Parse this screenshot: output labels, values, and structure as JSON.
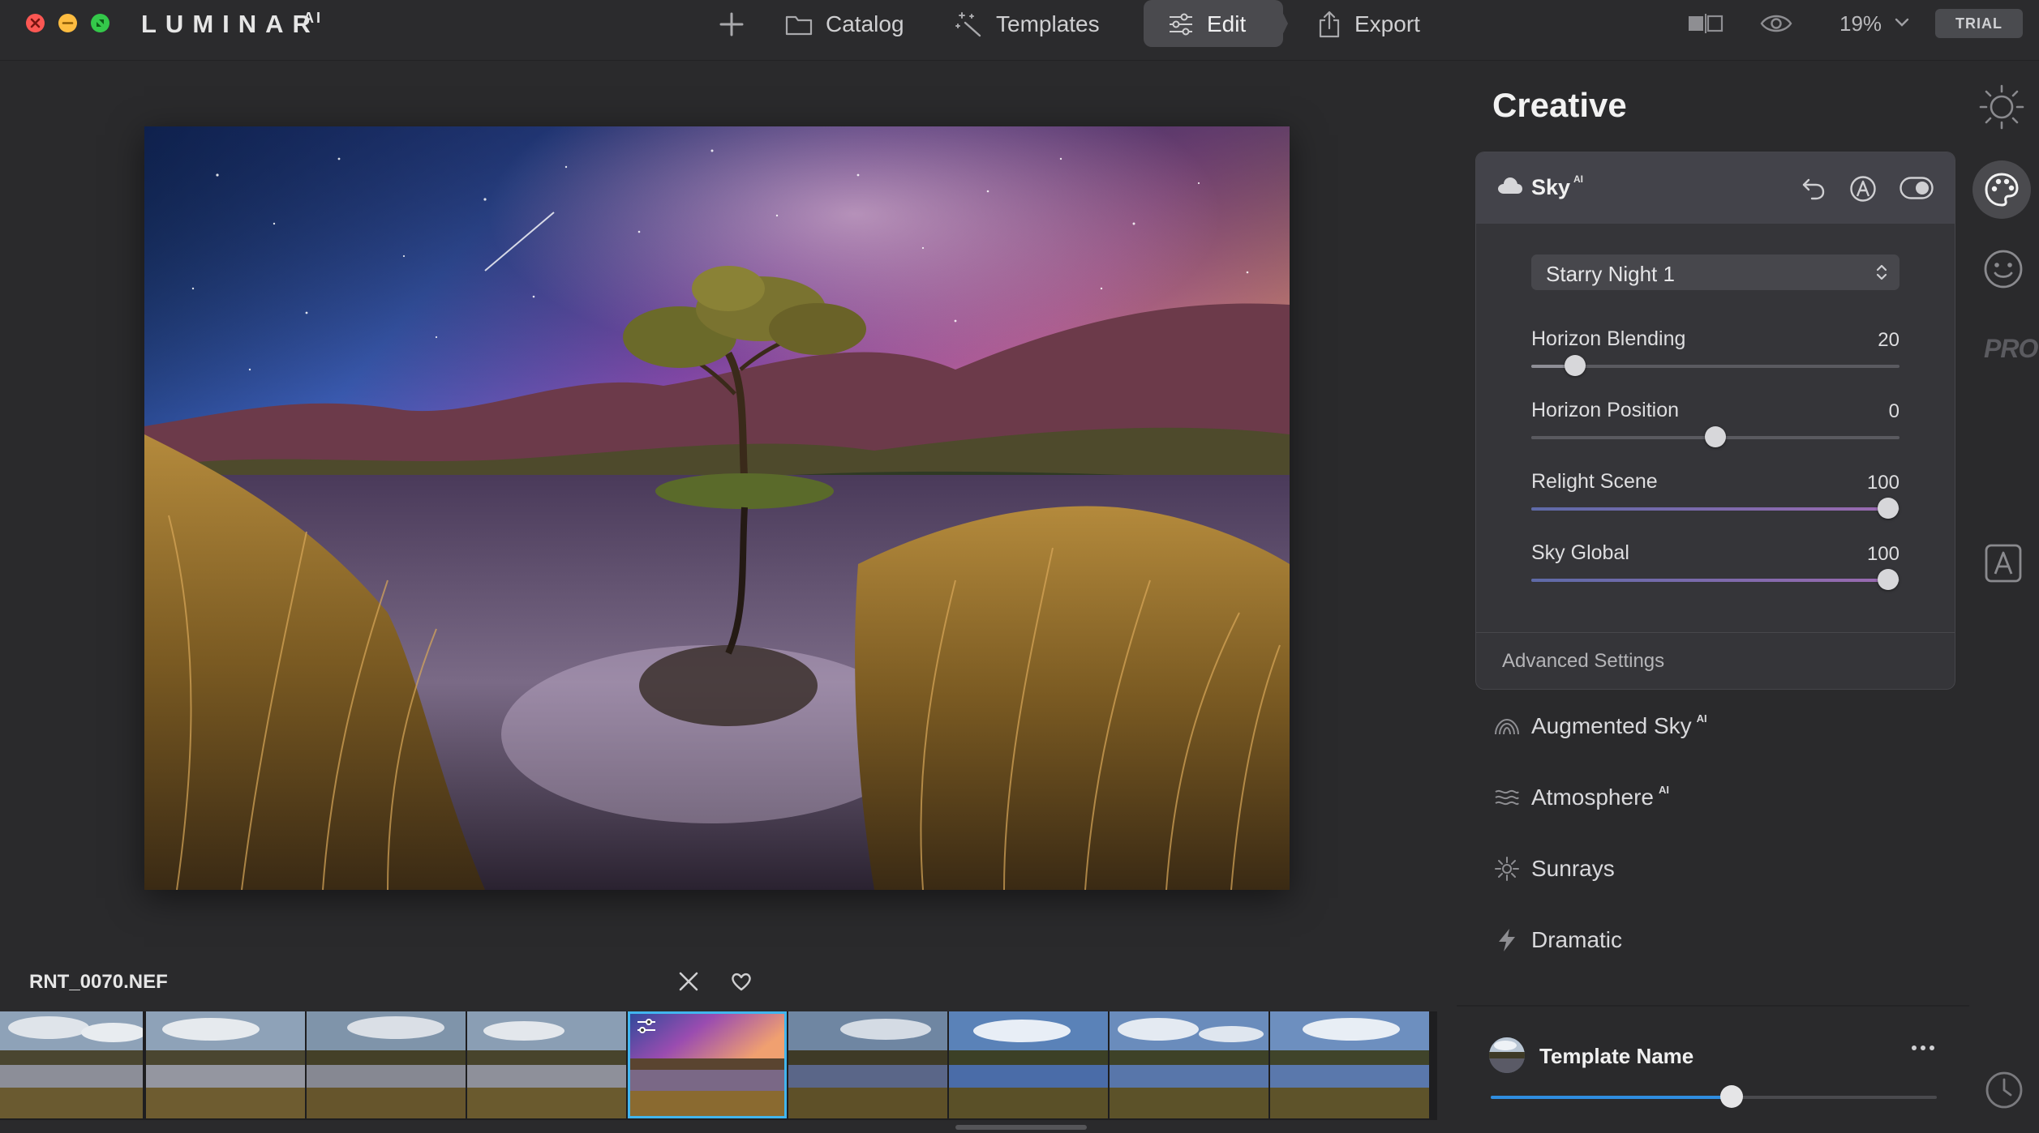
{
  "app": {
    "logo": "LUMINAR",
    "logo_suffix": "AI",
    "nav": {
      "catalog": "Catalog",
      "templates": "Templates",
      "edit": "Edit",
      "export": "Export"
    },
    "zoom": "19%",
    "trial": "TRIAL"
  },
  "colors": {
    "close": "#fc5753",
    "minimize": "#fdbc40",
    "maximize": "#34c84a",
    "accent": "#2f8de0",
    "selection": "#41b5ee"
  },
  "filmstrip": {
    "filename": "RNT_0070.NEF",
    "selected_index": 4,
    "count": 9
  },
  "panel": {
    "title": "Creative",
    "sky": {
      "title": "Sky",
      "title_suffix": "AI",
      "preset": "Starry Night 1",
      "sliders": [
        {
          "label": "Horizon Blending",
          "value": "20",
          "fraction": 0.12
        },
        {
          "label": "Horizon Position",
          "value": "0",
          "fraction": 0.5
        },
        {
          "label": "Relight Scene",
          "value": "100",
          "fraction": 0.97
        },
        {
          "label": "Sky Global",
          "value": "100",
          "fraction": 0.97
        }
      ],
      "advanced": "Advanced Settings"
    },
    "tools": [
      {
        "label": "Augmented Sky",
        "suffix": "AI",
        "icon": "augmented-sky-icon"
      },
      {
        "label": "Atmosphere",
        "suffix": "AI",
        "icon": "atmosphere-icon"
      },
      {
        "label": "Sunrays",
        "suffix": "",
        "icon": "sunrays-icon"
      },
      {
        "label": "Dramatic",
        "suffix": "",
        "icon": "lightning-icon"
      }
    ],
    "template": {
      "name": "Template Name",
      "amount_fraction": 0.54
    }
  },
  "rail": {
    "pro": "PRO"
  }
}
